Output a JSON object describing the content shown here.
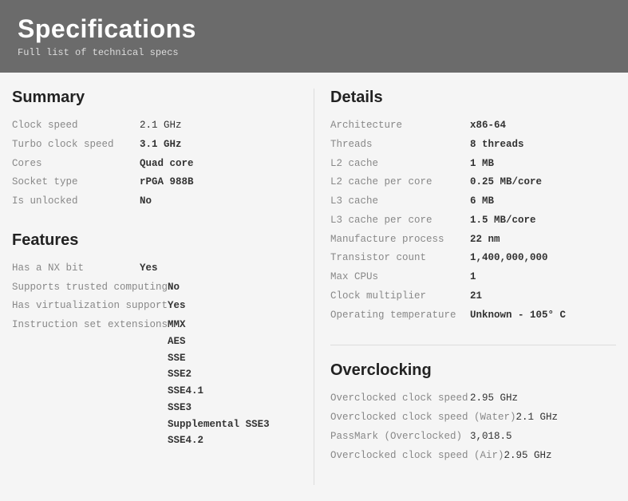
{
  "header": {
    "title": "Specifications",
    "subtitle": "Full list of technical specs"
  },
  "summary": {
    "heading": "Summary",
    "rows": [
      {
        "label": "Clock speed",
        "value": "2.1 GHz",
        "bold": false
      },
      {
        "label": "Turbo clock speed",
        "value": "3.1 GHz",
        "bold": true
      },
      {
        "label": "Cores",
        "value": "Quad core",
        "bold": true
      },
      {
        "label": "Socket type",
        "value": "rPGA 988B",
        "bold": true
      },
      {
        "label": "Is unlocked",
        "value": "No",
        "bold": true
      }
    ]
  },
  "features": {
    "heading": "Features",
    "rows": [
      {
        "label": "Has a NX bit",
        "value": "Yes",
        "bold": true
      },
      {
        "label": "Supports trusted computing",
        "value": "No",
        "bold": true
      },
      {
        "label": "Has virtualization support",
        "value": "Yes",
        "bold": true
      },
      {
        "label": "Instruction set extensions",
        "value": "",
        "bold": true
      }
    ],
    "extensions": [
      "MMX",
      "AES",
      "SSE",
      "SSE2",
      "SSE4.1",
      "SSE3",
      "Supplemental SSE3",
      "SSE4.2"
    ]
  },
  "details": {
    "heading": "Details",
    "rows": [
      {
        "label": "Architecture",
        "value": "x86-64"
      },
      {
        "label": "Threads",
        "value": "8 threads"
      },
      {
        "label": "L2 cache",
        "value": "1 MB"
      },
      {
        "label": "L2 cache per core",
        "value": "0.25 MB/core"
      },
      {
        "label": "L3 cache",
        "value": "6 MB"
      },
      {
        "label": "L3 cache per core",
        "value": "1.5 MB/core"
      },
      {
        "label": "Manufacture process",
        "value": "22 nm"
      },
      {
        "label": "Transistor count",
        "value": "1,400,000,000"
      },
      {
        "label": "Max CPUs",
        "value": "1"
      },
      {
        "label": "Clock multiplier",
        "value": "21"
      },
      {
        "label": "Operating temperature",
        "value": "Unknown - 105° C"
      }
    ]
  },
  "overclocking": {
    "heading": "Overclocking",
    "rows": [
      {
        "label": "Overclocked clock speed",
        "value": "2.95 GHz"
      },
      {
        "label": "Overclocked clock speed (Water)",
        "value": "2.1 GHz"
      },
      {
        "label": "PassMark (Overclocked)",
        "value": "3,018.5"
      },
      {
        "label": "Overclocked clock speed (Air)",
        "value": "2.95 GHz"
      }
    ]
  }
}
